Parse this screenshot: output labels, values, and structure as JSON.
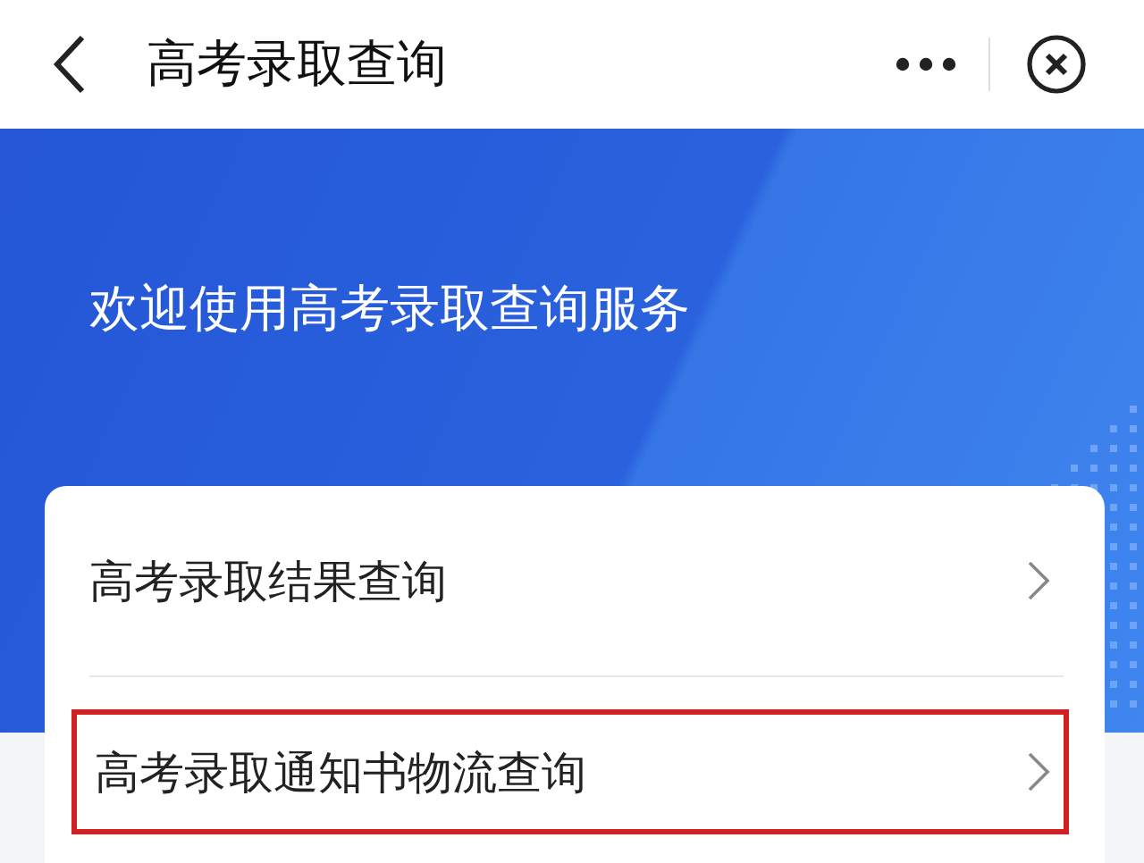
{
  "header": {
    "title": "高考录取查询"
  },
  "banner": {
    "title": "欢迎使用高考录取查询服务"
  },
  "menu_items": [
    {
      "label": "高考录取结果查询",
      "highlighted": false
    },
    {
      "label": "高考录取通知书物流查询",
      "highlighted": true
    }
  ]
}
